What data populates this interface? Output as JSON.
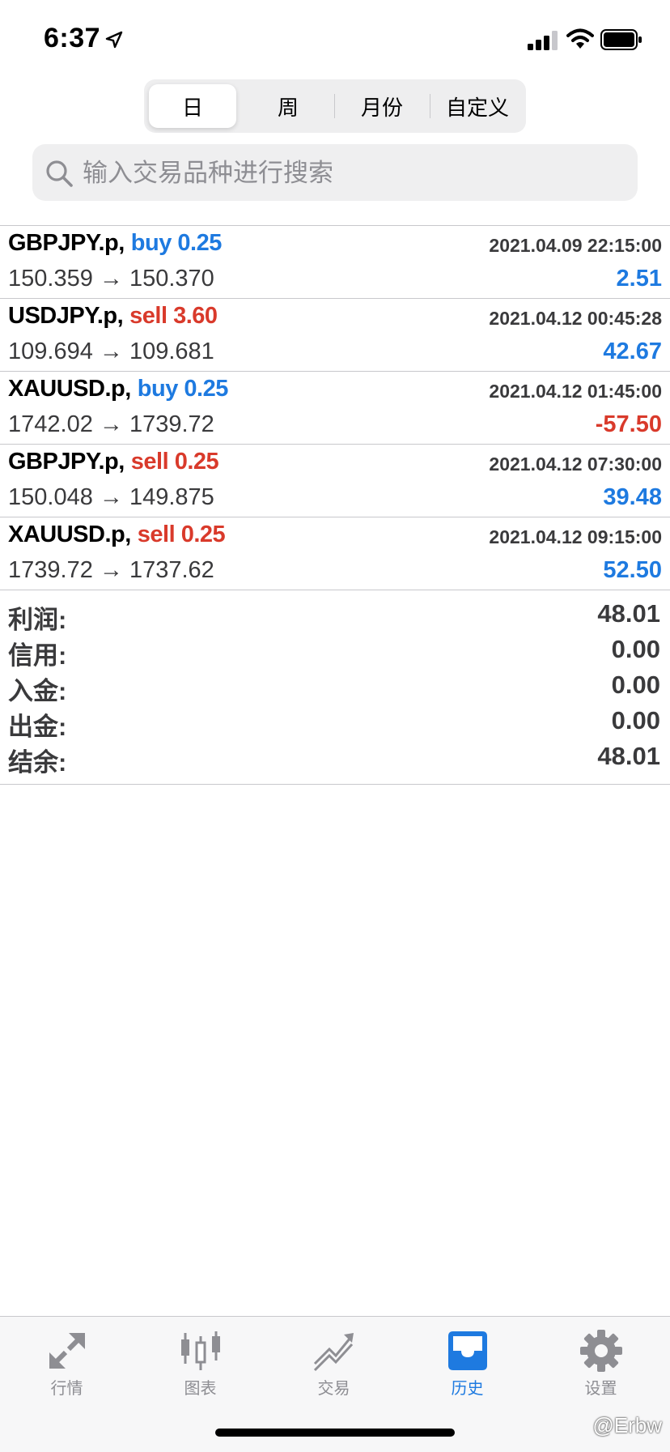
{
  "status_bar": {
    "time": "6:37"
  },
  "segments": [
    {
      "label": "日",
      "active": true
    },
    {
      "label": "周",
      "active": false
    },
    {
      "label": "月份",
      "active": false
    },
    {
      "label": "自定义",
      "active": false
    }
  ],
  "search": {
    "placeholder": "输入交易品种进行搜索"
  },
  "trades": [
    {
      "symbol": "GBPJPY.p,",
      "side": "buy 0.25",
      "time": "2021.04.09 22:15:00",
      "prices": "150.359 → 150.370",
      "profit": "2.51"
    },
    {
      "symbol": "USDJPY.p,",
      "side": "sell 3.60",
      "time": "2021.04.12 00:45:28",
      "prices": "109.694 → 109.681",
      "profit": "42.67"
    },
    {
      "symbol": "XAUUSD.p,",
      "side": "buy 0.25",
      "time": "2021.04.12 01:45:00",
      "prices": "1742.02 → 1739.72",
      "profit": "-57.50"
    },
    {
      "symbol": "GBPJPY.p,",
      "side": "sell 0.25",
      "time": "2021.04.12 07:30:00",
      "prices": "150.048 → 149.875",
      "profit": "39.48"
    },
    {
      "symbol": "XAUUSD.p,",
      "side": "sell 0.25",
      "time": "2021.04.12 09:15:00",
      "prices": "1739.72 → 1737.62",
      "profit": "52.50"
    }
  ],
  "summary": [
    {
      "label": "利润:",
      "value": "48.01"
    },
    {
      "label": "信用:",
      "value": "0.00"
    },
    {
      "label": "入金:",
      "value": "0.00"
    },
    {
      "label": "出金:",
      "value": "0.00"
    },
    {
      "label": "结余:",
      "value": "48.01"
    }
  ],
  "tab_bar": [
    {
      "label": "行情",
      "icon": "quotes-arrows-icon",
      "active": false
    },
    {
      "label": "图表",
      "icon": "candlestick-chart-icon",
      "active": false
    },
    {
      "label": "交易",
      "icon": "trade-trend-icon",
      "active": false
    },
    {
      "label": "历史",
      "icon": "history-inbox-icon",
      "active": true
    },
    {
      "label": "设置",
      "icon": "gear-icon",
      "active": false
    }
  ],
  "watermark": "@Erbw",
  "colors": {
    "accent": "#1e7ae0",
    "negative": "#d93a2b",
    "text_secondary": "#3a3a3c",
    "inactive": "#8e8e93"
  }
}
